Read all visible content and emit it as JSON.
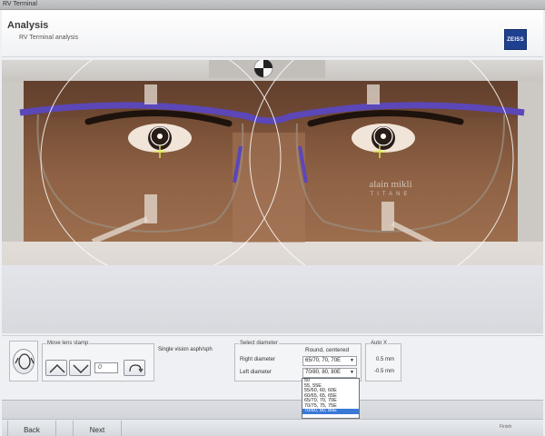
{
  "window": {
    "title": "RV Terminal"
  },
  "header": {
    "title": "Analysis",
    "subtitle": "RV Terminal analysis",
    "logo_text": "ZEISS"
  },
  "photo": {
    "frame_brand": "alain mikli",
    "frame_model": "TITANE"
  },
  "controls": {
    "move_lens_stamp_label": "Move lens stamp",
    "stamp_field_value": "0",
    "lens_type": "Single vision asph/sph",
    "select_diameter_label": "Select diameter",
    "shape_value": "Round, centered",
    "right_diameter_label": "Right diameter",
    "right_diameter_value": "65/70, 70, 70E",
    "left_diameter_label": "Left diameter",
    "left_diameter_value": "70/80, 80, 80E",
    "auto_x_label": "Auto X",
    "auto_x_top": "0.5 mm",
    "auto_x_bottom": "-0.5 mm"
  },
  "dropdown": {
    "options": [
      "50",
      "55, 55E",
      "55/60, 60, 60E",
      "60/65, 65, 65E",
      "65/70, 70, 70E",
      "70/75, 75, 75E",
      "70/80, 80, 80E"
    ],
    "selected_index": 6
  },
  "footer": {
    "back_label": "Back",
    "next_label": "Next",
    "finish_label": "Finish"
  },
  "colors": {
    "accent": "#3a79d8",
    "crosshair": "#e4e84a",
    "logo_bg": "#1f3f8f",
    "frame_purple": "#5b47b8"
  }
}
